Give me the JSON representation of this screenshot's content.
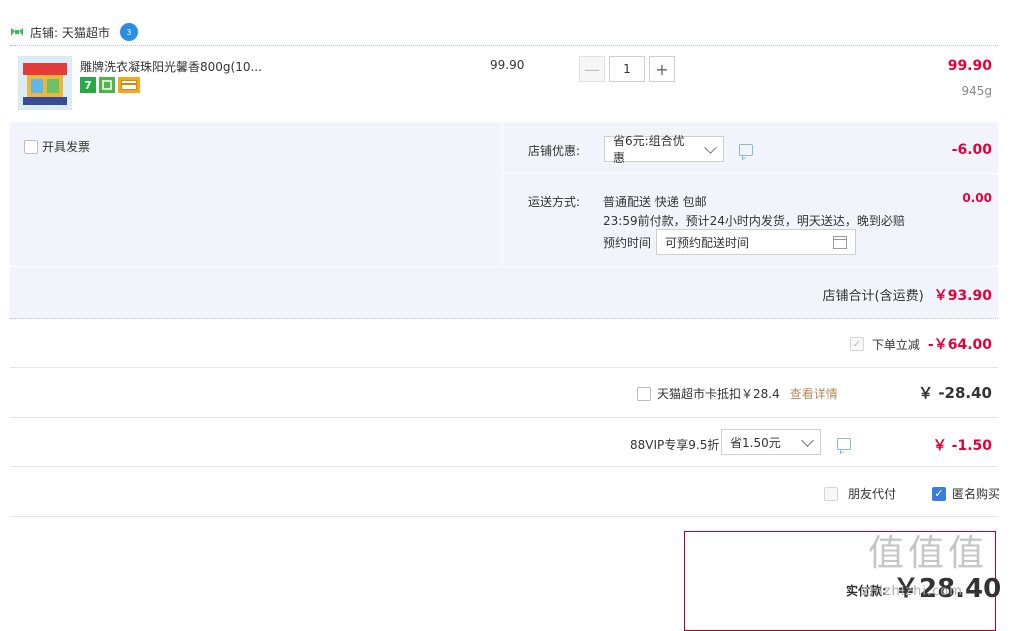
{
  "shop": {
    "label": "店铺: 天猫超市",
    "badge": "3"
  },
  "product": {
    "title": "雕牌洗衣凝珠阳光馨香800g(10...",
    "tags": [
      "7",
      "",
      ""
    ],
    "unit_price": "99.90",
    "qty": {
      "value": "1",
      "minus": "—",
      "plus": "+"
    },
    "line_price": "99.90",
    "weight": "945g"
  },
  "invoice": {
    "label": "开具发票"
  },
  "shop_discount": {
    "label": "店铺优惠:",
    "selected": "省6元:组合优惠",
    "amount": "-6.00"
  },
  "shipping": {
    "label": "运送方式:",
    "line1": "普通配送 快递 包邮",
    "line2": "23:59前付款，预计24小时内发货，明天送达，晚到必赔",
    "reserve_label": "预约时间",
    "reserve_placeholder": "可预约配送时间",
    "amount": "0.00"
  },
  "shop_total": {
    "label": "店铺合计(含运费)",
    "amount": "￥93.90"
  },
  "instant_discount": {
    "label": "下单立减",
    "amount": "-￥64.00"
  },
  "tmall_card": {
    "label": "天猫超市卡抵扣￥28.4",
    "link": "查看详情",
    "amount": "￥ -28.40"
  },
  "vip": {
    "label": "88VIP专享9.5折",
    "selected": "省1.50元",
    "amount": "￥ -1.50"
  },
  "options": {
    "friend_pay": "朋友代付",
    "anonymous": "匿名购买"
  },
  "payment": {
    "label": "实付款:",
    "amount": "￥28.40"
  },
  "watermark": {
    "big": "值值值",
    "url": "zhizhizhi.com"
  }
}
